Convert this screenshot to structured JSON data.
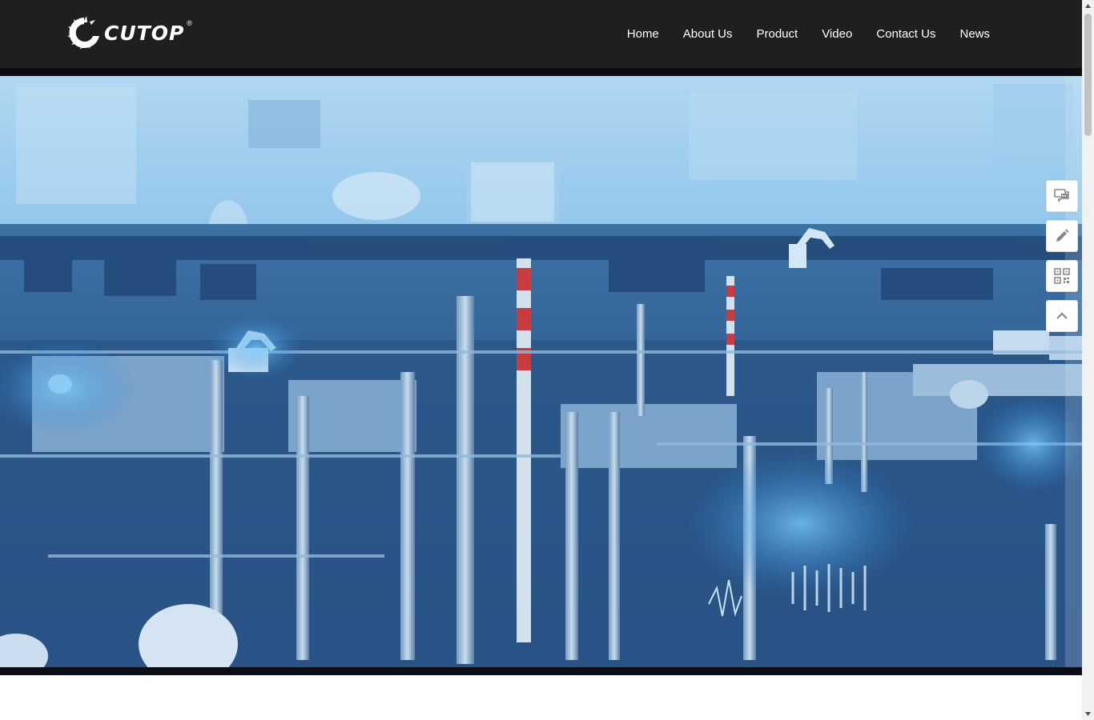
{
  "brand": {
    "name": "CUTOP",
    "registered_mark": "®",
    "header_bg": "#1f1f1f"
  },
  "nav": {
    "items": [
      {
        "label": "Home"
      },
      {
        "label": "About Us"
      },
      {
        "label": "Product"
      },
      {
        "label": "Video"
      },
      {
        "label": "Contact Us"
      },
      {
        "label": "News"
      }
    ]
  },
  "hero": {
    "icon": "industrial-refinery-banner-image",
    "tint": "#3f8fd8"
  },
  "side_tools": [
    {
      "icon": "chat-icon"
    },
    {
      "icon": "pencil-icon"
    },
    {
      "icon": "qr-code-icon"
    },
    {
      "icon": "chevron-up-icon"
    }
  ]
}
